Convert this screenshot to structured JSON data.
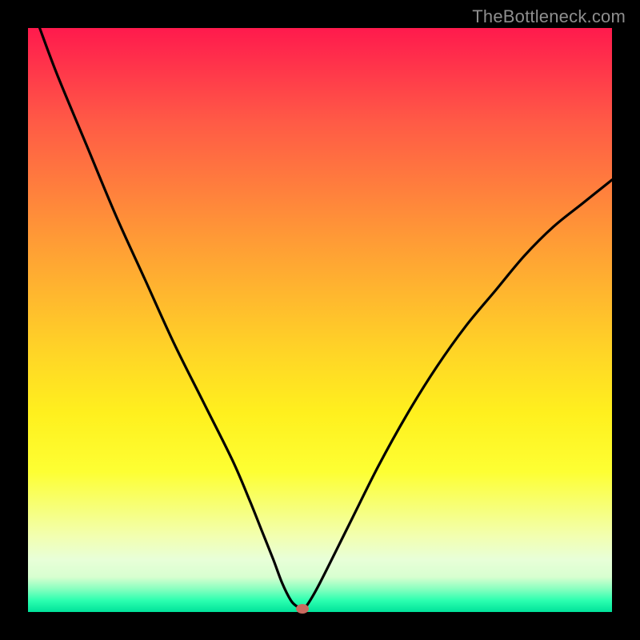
{
  "watermark": "TheBottleneck.com",
  "chart_data": {
    "type": "line",
    "title": "",
    "xlabel": "",
    "ylabel": "",
    "xlim": [
      0,
      100
    ],
    "ylim": [
      0,
      100
    ],
    "curve": {
      "name": "bottleneck-curve",
      "x": [
        2,
        5,
        10,
        15,
        20,
        25,
        30,
        35,
        38,
        40,
        42,
        43.5,
        45,
        46,
        47,
        48,
        50,
        55,
        60,
        65,
        70,
        75,
        80,
        85,
        90,
        95,
        100
      ],
      "y": [
        100,
        92,
        80,
        68,
        57,
        46,
        36,
        26,
        19,
        14,
        9,
        5,
        2,
        1,
        0.5,
        1.5,
        5,
        15,
        25,
        34,
        42,
        49,
        55,
        61,
        66,
        70,
        74
      ]
    },
    "marker": {
      "x": 47,
      "y": 0.5
    },
    "gradient_stops": [
      {
        "pos": 0,
        "color": "#ff1a4d"
      },
      {
        "pos": 50,
        "color": "#ffcc22"
      },
      {
        "pos": 85,
        "color": "#fdff33"
      },
      {
        "pos": 100,
        "color": "#00e29a"
      }
    ]
  }
}
